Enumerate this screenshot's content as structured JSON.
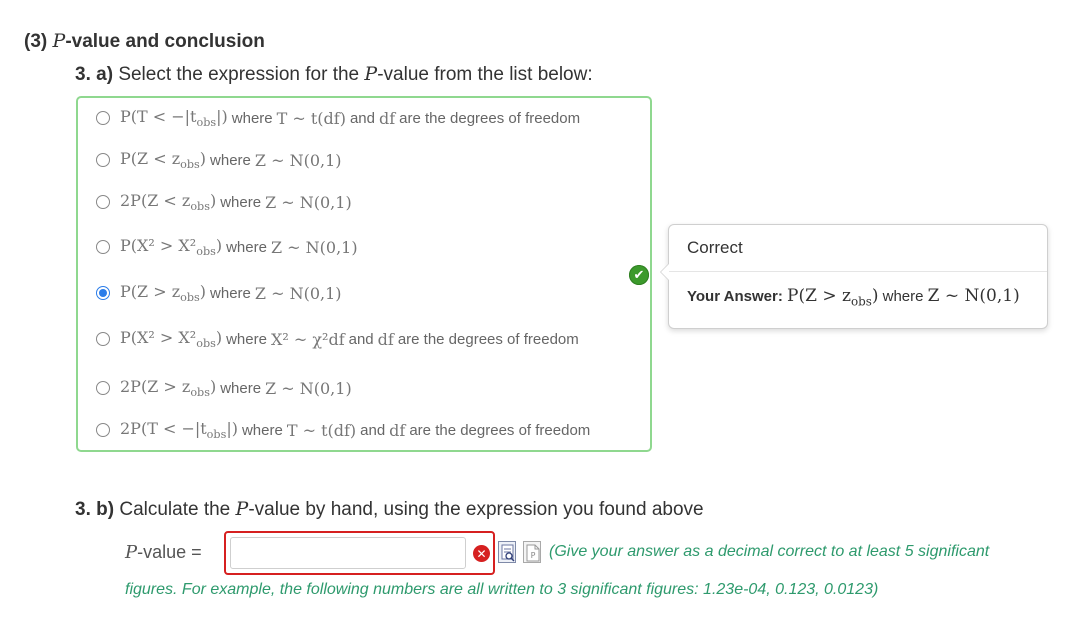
{
  "section": {
    "number": "(3)",
    "p_symbol": "P",
    "title": "-value and conclusion"
  },
  "q3a": {
    "number": "3. a)",
    "prompt_before": "Select the expression for the",
    "p_symbol": "P",
    "prompt_after": "-value from the list below:",
    "choices": [
      {
        "expr": "P(T < −|t",
        "sub": "obs",
        "expr_end": "|)",
        "where": "where",
        "dist": "T ~ t(df)",
        "tail": "and",
        "tail_expr": "df",
        "tail_end": "are the degrees of freedom",
        "selected": false
      },
      {
        "expr": "P(Z < z",
        "sub": "obs",
        "expr_end": ")",
        "where": "where",
        "dist": "Z ~ N(0,1)",
        "tail": "",
        "tail_expr": "",
        "tail_end": "",
        "selected": false
      },
      {
        "expr": "2P(Z < z",
        "sub": "obs",
        "expr_end": ")",
        "where": "where",
        "dist": "Z ~ N(0,1)",
        "tail": "",
        "tail_expr": "",
        "tail_end": "",
        "selected": false
      },
      {
        "expr": "P(X² > X²",
        "sub": "obs",
        "expr_end": ")",
        "where": "where",
        "dist": "Z ~ N(0,1)",
        "tail": "",
        "tail_expr": "",
        "tail_end": "",
        "selected": false
      },
      {
        "expr": "P(Z > z",
        "sub": "obs",
        "expr_end": ")",
        "where": "where",
        "dist": "Z ~ N(0,1)",
        "tail": "",
        "tail_expr": "",
        "tail_end": "",
        "selected": true
      },
      {
        "expr": "P(X² > X²",
        "sub": "obs",
        "expr_end": ")",
        "where": "where",
        "dist": "X² ~ χ²df",
        "tail": "and",
        "tail_expr": "df",
        "tail_end": "are the degrees of freedom",
        "selected": false
      },
      {
        "expr": "2P(Z > z",
        "sub": "obs",
        "expr_end": ")",
        "where": "where",
        "dist": "Z ~ N(0,1)",
        "tail": "",
        "tail_expr": "",
        "tail_end": "",
        "selected": false
      },
      {
        "expr": "2P(T < −|t",
        "sub": "obs",
        "expr_end": "|)",
        "where": "where",
        "dist": "T ~ t(df)",
        "tail": "and",
        "tail_expr": "df",
        "tail_end": "are the degrees of freedom",
        "selected": false
      }
    ]
  },
  "feedback": {
    "status_icon": "check-icon",
    "header": "Correct",
    "answer_label": "Your Answer:",
    "answer_expr": "P(Z > z",
    "answer_sub": "obs",
    "answer_expr_end": ")",
    "answer_where": "where",
    "answer_dist": "Z ~ N(0,1)"
  },
  "q3b": {
    "number": "3. b)",
    "prompt_before": "Calculate the",
    "p_symbol": "P",
    "prompt_after": "-value by hand, using the expression you found above",
    "input_label_p": "P",
    "input_label_rest": "-value =",
    "input_value": "",
    "input_placeholder": "",
    "status_icon": "x-icon",
    "hint_line1": "(Give your answer as a decimal correct to at least 5 significant",
    "hint_line2": "figures. For example, the following numbers are all written to 3 significant figures: 1.23e-04, 0.123, 0.0123)"
  },
  "colors": {
    "correct_border": "#8fd88f",
    "correct_badge": "#3c9a2c",
    "error_border": "#d62020",
    "hint_text": "#2e9a6d",
    "radio_selected": "#2b7de9"
  }
}
